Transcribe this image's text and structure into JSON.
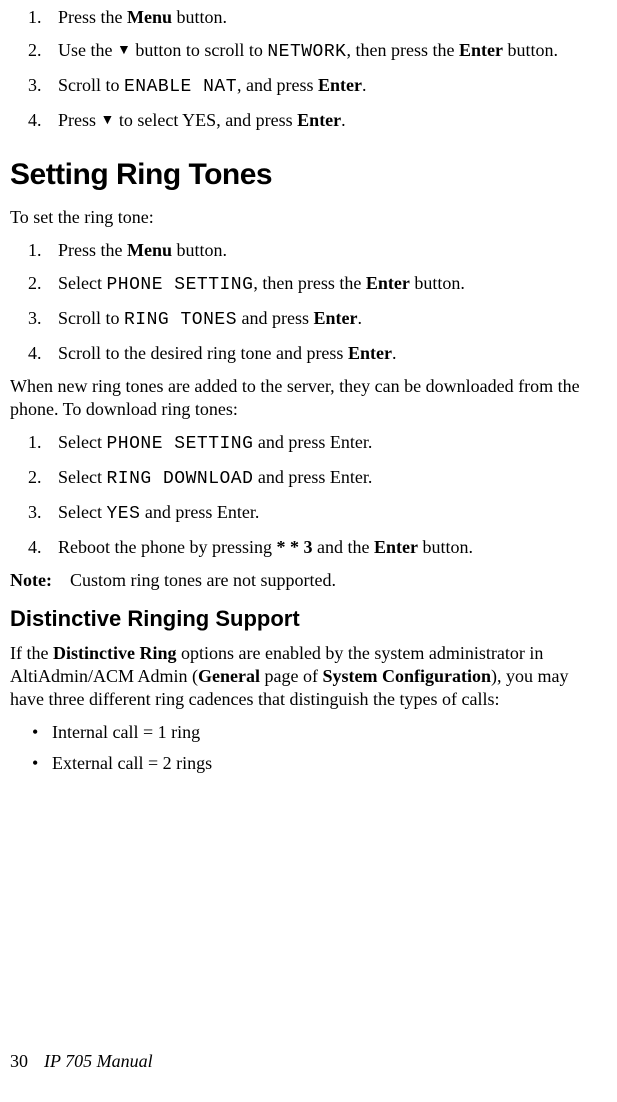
{
  "block1": {
    "s1_a": "Press the ",
    "s1_b": "Menu",
    "s1_c": " button.",
    "s2_a": "Use the ",
    "s2_b": " button to scroll to ",
    "s2_c": "NETWORK",
    "s2_d": ", then press the ",
    "s2_e": "Enter",
    "s2_f": " button.",
    "s3_a": "Scroll to ",
    "s3_b": "ENABLE NAT",
    "s3_c": ", and press ",
    "s3_d": "Enter",
    "s3_e": ".",
    "s4_a": "Press ",
    "s4_b": " to select YES, and press ",
    "s4_c": "Enter",
    "s4_d": "."
  },
  "arrow_glyph": "▼",
  "heading1": "Setting Ring Tones",
  "intro1": "To set the ring tone:",
  "block2": {
    "s1_a": "Press the ",
    "s1_b": "Menu",
    "s1_c": " button.",
    "s2_a": "Select ",
    "s2_b": "PHONE SETTING",
    "s2_c": ", then press the ",
    "s2_d": "Enter",
    "s2_e": " button.",
    "s3_a": "Scroll to ",
    "s3_b": "RING TONES",
    "s3_c": " and press ",
    "s3_d": "Enter",
    "s3_e": ".",
    "s4_a": "Scroll to the desired ring tone and press ",
    "s4_b": "Enter",
    "s4_c": "."
  },
  "intro2": "When new ring tones are added to the server, they can be downloaded from the phone. To download ring tones:",
  "block3": {
    "s1_a": "Select ",
    "s1_b": "PHONE SETTING",
    "s1_c": " and press Enter.",
    "s2_a": "Select ",
    "s2_b": "RING DOWNLOAD",
    "s2_c": " and press Enter.",
    "s3_a": "Select ",
    "s3_b": "YES",
    "s3_c": " and press Enter.",
    "s4_a": "Reboot the phone by pressing ",
    "s4_b": "* * 3",
    "s4_c": " and the ",
    "s4_d": "Enter",
    "s4_e": " button."
  },
  "note_label": "Note:",
  "note_text": "Custom ring tones are not supported.",
  "heading2": "Distinctive Ringing Support",
  "dist_a": "If the ",
  "dist_b": "Distinctive Ring",
  "dist_c": " options are enabled by the system administrator in AltiAdmin/ACM Admin (",
  "dist_d": "General",
  "dist_e": " page of ",
  "dist_f": "System Configuration",
  "dist_g": "), you may have three different ring cadences that distinguish the types of calls:",
  "bullets": {
    "b1": "Internal call = 1 ring",
    "b2": "External call = 2 rings"
  },
  "nums": {
    "n1": "1.",
    "n2": "2.",
    "n3": "3.",
    "n4": "4."
  },
  "bullet_glyph": "•",
  "footer_page": "30",
  "footer_book": "IP 705 Manual"
}
